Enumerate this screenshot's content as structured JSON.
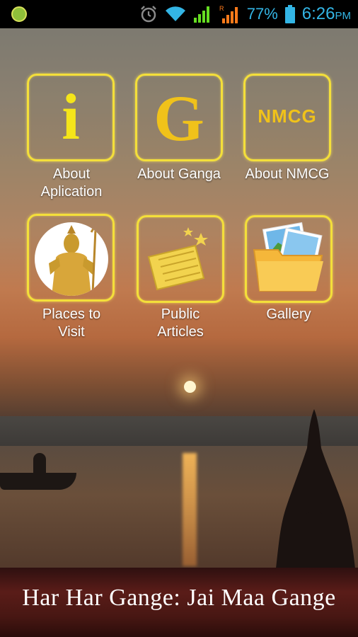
{
  "status_bar": {
    "battery": "77%",
    "time": "6:26",
    "ampm": "PM",
    "icons": [
      "app-notification-icon",
      "alarm-icon",
      "wifi-icon",
      "signal-icon",
      "roaming-signal-icon",
      "battery-icon"
    ]
  },
  "menu": {
    "items": [
      {
        "label_line1": "About",
        "label_line2": "Aplication",
        "icon": "info-icon",
        "glyph": "i"
      },
      {
        "label_line1": "About Ganga",
        "label_line2": "",
        "icon": "ganga-g-icon",
        "glyph": "G"
      },
      {
        "label_line1": "About NMCG",
        "label_line2": "",
        "icon": "nmcg-icon",
        "glyph": "NMCG"
      },
      {
        "label_line1": "Places to",
        "label_line2": "Visit",
        "icon": "shiva-icon",
        "glyph": ""
      },
      {
        "label_line1": "Public",
        "label_line2": "Articles",
        "icon": "newspaper-icon",
        "glyph": ""
      },
      {
        "label_line1": "Gallery",
        "label_line2": "",
        "icon": "folder-photos-icon",
        "glyph": ""
      }
    ]
  },
  "footer": {
    "caption": "Har Har Gange: Jai Maa Gange"
  },
  "colors": {
    "accent_status": "#33b5e5",
    "tile_border": "#f4df3a",
    "icon_yellow": "#f0c21a"
  }
}
